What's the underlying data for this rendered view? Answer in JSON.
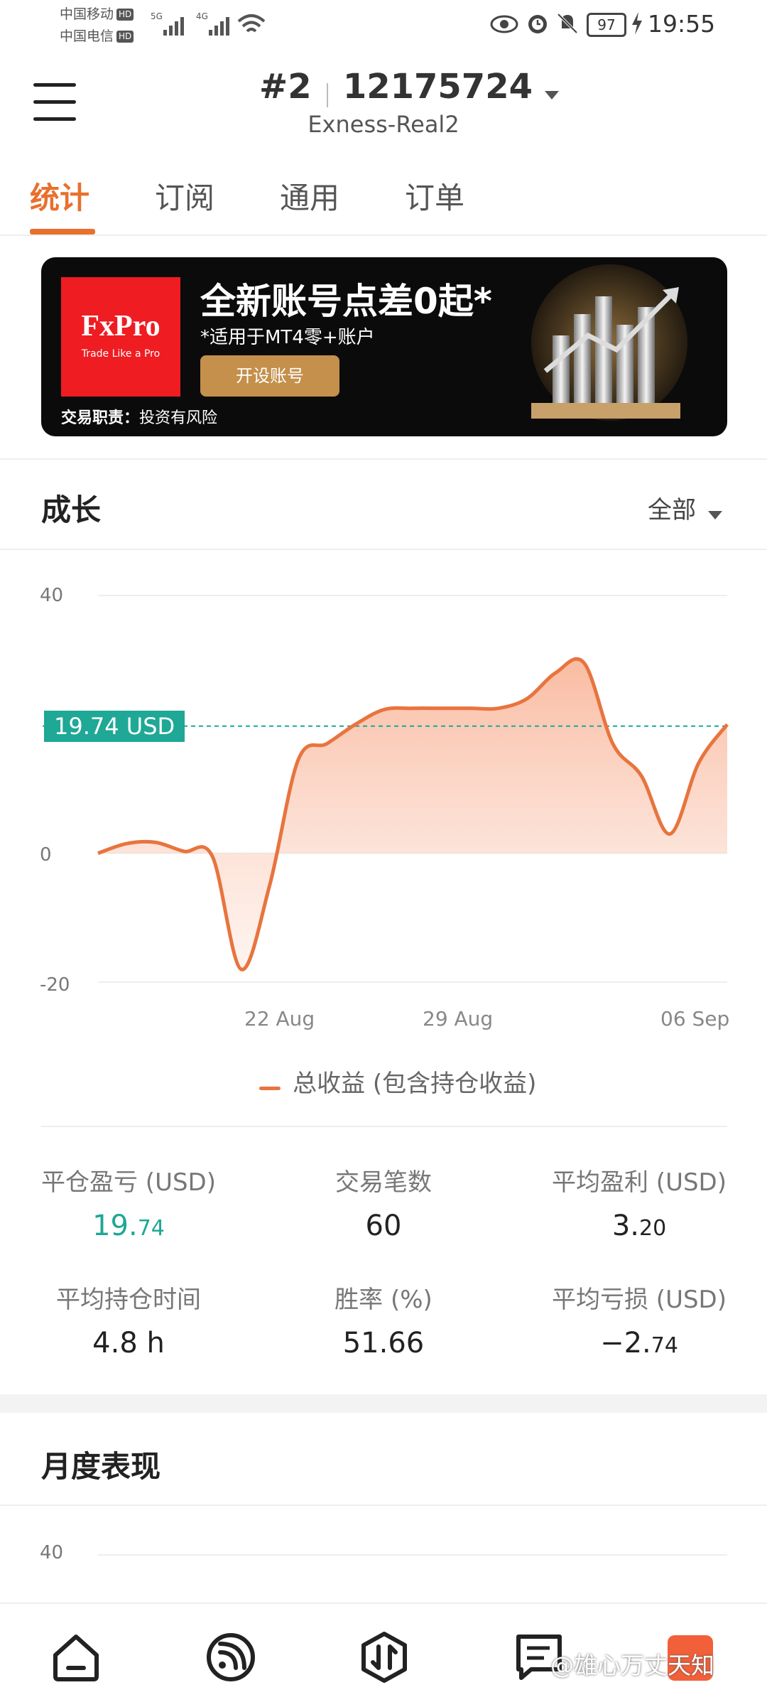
{
  "status_bar": {
    "carrier1": "中国移动",
    "carrier2": "中国电信",
    "hd": "HD",
    "net1": "5G",
    "net2": "4G",
    "battery": "97",
    "time": "19:55"
  },
  "header": {
    "account_prefix": "#2",
    "account_number": "12175724",
    "server": "Exness-Real2"
  },
  "tabs": [
    {
      "label": "统计",
      "active": true
    },
    {
      "label": "订阅",
      "active": false
    },
    {
      "label": "通用",
      "active": false
    },
    {
      "label": "订单",
      "active": false
    }
  ],
  "banner": {
    "brand": "FxPro",
    "tagline": "Trade Like a Pro",
    "title": "全新账号点差0起*",
    "subtitle": "*适用于MT4零+账户",
    "button": "开设账号",
    "risk_label": "交易职责：",
    "risk_text": "投资有风险"
  },
  "growth": {
    "title": "成长",
    "filter": "全部",
    "current_label": "19.74 USD",
    "legend": "总收益 (包含持仓收益)"
  },
  "chart_data": {
    "type": "area",
    "y_ticks": [
      "40",
      "0",
      "-20"
    ],
    "x_ticks": [
      "22 Aug",
      "29 Aug",
      "06 Sep"
    ],
    "ylim": [
      -20,
      40
    ],
    "series": [
      {
        "name": "总收益 (包含持仓收益)",
        "points": [
          {
            "x": "15 Aug",
            "y": 0
          },
          {
            "x": "16 Aug",
            "y": 1.5
          },
          {
            "x": "17 Aug",
            "y": 1.7
          },
          {
            "x": "18 Aug",
            "y": 0.3
          },
          {
            "x": "19 Aug",
            "y": -0.5
          },
          {
            "x": "20 Aug",
            "y": -18
          },
          {
            "x": "21 Aug",
            "y": -5
          },
          {
            "x": "22 Aug",
            "y": 14.5
          },
          {
            "x": "23 Aug",
            "y": 17
          },
          {
            "x": "24 Aug",
            "y": 20
          },
          {
            "x": "25 Aug",
            "y": 22.3
          },
          {
            "x": "26 Aug",
            "y": 22.5
          },
          {
            "x": "27 Aug",
            "y": 22.5
          },
          {
            "x": "28 Aug",
            "y": 22.5
          },
          {
            "x": "29 Aug",
            "y": 22.5
          },
          {
            "x": "30 Aug",
            "y": 24
          },
          {
            "x": "31 Aug",
            "y": 28
          },
          {
            "x": "01 Sep",
            "y": 29.5
          },
          {
            "x": "02 Sep",
            "y": 17
          },
          {
            "x": "03 Sep",
            "y": 12
          },
          {
            "x": "04 Sep",
            "y": 3
          },
          {
            "x": "05 Sep",
            "y": 14
          },
          {
            "x": "06 Sep",
            "y": 20
          }
        ]
      }
    ],
    "reference_line": 19.74,
    "grid": true,
    "legend_position": "bottom"
  },
  "stats": [
    {
      "label": "平仓盈亏 (USD)",
      "value_main": "19.",
      "value_small": "74",
      "color": "#1ea895"
    },
    {
      "label": "交易笔数",
      "value_main": "60",
      "value_small": ""
    },
    {
      "label": "平均盈利 (USD)",
      "value_main": "3.",
      "value_small": "20"
    },
    {
      "label": "平均持仓时间",
      "value_main": "4.8 h",
      "value_small": ""
    },
    {
      "label": "胜率 (%)",
      "value_main": "51.66",
      "value_small": ""
    },
    {
      "label": "平均亏损 (USD)",
      "value_main": "−2.",
      "value_small": "74"
    }
  ],
  "monthly": {
    "title": "月度表现",
    "y_tick_top": "40"
  },
  "bottom_nav": {
    "icons": [
      "home-icon",
      "signal-icon",
      "trade-icon",
      "chat-icon"
    ],
    "watermark": "@雄心万丈天知"
  }
}
